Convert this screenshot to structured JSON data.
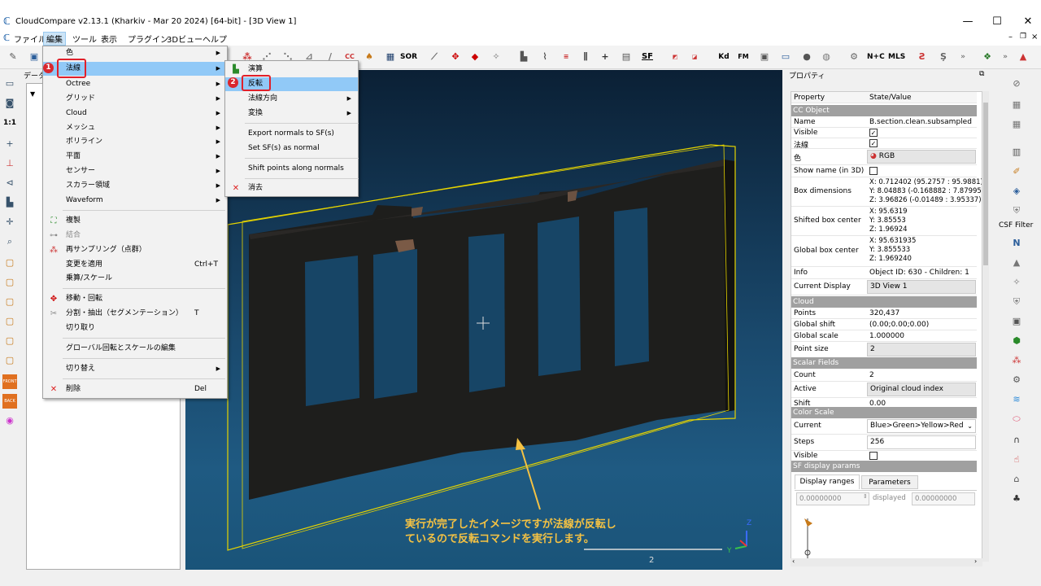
{
  "window": {
    "title": "CloudCompare v2.13.1 (Kharkiv - Mar 20 2024) [64-bit] - [3D View 1]",
    "minimize": "—",
    "maximize": "☐",
    "close": "✕"
  },
  "menubar": [
    "ファイル",
    "編集",
    "ツール",
    "表示",
    "プラグイン",
    "3Dビュー",
    "ヘルプ"
  ],
  "toolbar": {
    "sor": "SOR",
    "sf": "SF",
    "kd": "Kd",
    "fm": "FM",
    "ncc": "N+C",
    "mls": "MLS"
  },
  "left_toolbar": {
    "one_to_one": "1:1",
    "front": "FRONT",
    "back": "BACK"
  },
  "db_panel": {
    "title": "データ"
  },
  "properties": {
    "title": "プロパティ",
    "header_key": "Property",
    "header_value": "State/Value",
    "sections": {
      "cc_object": "CC Object",
      "cloud": "Cloud",
      "scalar_fields": "Scalar Fields",
      "color_scale": "Color Scale",
      "sf_display": "SF display params"
    },
    "rows": {
      "name_k": "Name",
      "name_v": "B.section.clean.subsampled",
      "visible_k": "Visible",
      "normals_k": "法線",
      "color_k": "色",
      "color_v": "RGB",
      "show_name_k": "Show name (in 3D)",
      "box_dim_k": "Box dimensions",
      "box_dim_v": "X: 0.712402 (95.2757 : 95.9881)\nY: 8.04883 (-0.168882 : 7.87995)\nZ: 3.96826 (-0.01489 : 3.95337)",
      "shifted_k": "Shifted box center",
      "shifted_v": "X: 95.6319\nY: 3.85553\nZ: 1.96924",
      "global_k": "Global box center",
      "global_v": "X: 95.631935\nY: 3.855533\nZ: 1.969240",
      "info_k": "Info",
      "info_v": "Object ID: 630 - Children: 1",
      "display_k": "Current Display",
      "display_v": "3D View 1",
      "points_k": "Points",
      "points_v": "320,437",
      "gshift_k": "Global shift",
      "gshift_v": "(0.00;0.00;0.00)",
      "gscale_k": "Global scale",
      "gscale_v": "1.000000",
      "psize_k": "Point size",
      "psize_v": "2",
      "count_k": "Count",
      "count_v": "2",
      "active_k": "Active",
      "active_v": "Original cloud index",
      "shift_k": "Shift",
      "shift_v": "0.00",
      "current_k": "Current",
      "current_v": "Blue>Green>Yellow>Red",
      "steps_k": "Steps",
      "steps_v": "256",
      "cs_visible_k": "Visible"
    },
    "tabs": [
      "Display ranges",
      "Parameters"
    ],
    "range_min": "0.00000000",
    "range_label": "displayed",
    "range_displayed": "0.00000000"
  },
  "right_toolbar": {
    "csf": "CSF Filter"
  },
  "edit_menu": [
    {
      "label": "色",
      "arrow": true
    },
    {
      "label": "法線",
      "arrow": true,
      "highlight": true
    },
    {
      "label": "Octree",
      "arrow": true
    },
    {
      "label": "グリッド",
      "arrow": true
    },
    {
      "label": "Cloud",
      "arrow": true
    },
    {
      "label": "メッシュ",
      "arrow": true
    },
    {
      "label": "ポリライン",
      "arrow": true
    },
    {
      "label": "平面",
      "arrow": true
    },
    {
      "label": "センサー",
      "arrow": true
    },
    {
      "label": "スカラー領域",
      "arrow": true
    },
    {
      "label": "Waveform",
      "arrow": true
    },
    {
      "label": "複製",
      "icon": "clone-icon"
    },
    {
      "label": "結合",
      "icon": "merge-icon",
      "disabled": true
    },
    {
      "label": "再サンプリング（点群）",
      "icon": "subsample-icon"
    },
    {
      "label": "変更を適用",
      "shortcut": "Ctrl+T"
    },
    {
      "label": "乗算/スケール"
    },
    {
      "label": "移動・回転",
      "icon": "translate-rotate-icon"
    },
    {
      "label": "分割・抽出（セグメンテーション）",
      "icon": "segment-icon",
      "shortcut": "T"
    },
    {
      "label": "切り取り"
    },
    {
      "label": "グローバル回転とスケールの編集"
    },
    {
      "label": "切り替え",
      "arrow": true
    },
    {
      "label": "削除",
      "icon": "delete-icon",
      "shortcut": "Del"
    }
  ],
  "normals_submenu": [
    {
      "label": "演算",
      "icon": "compute-normals-icon"
    },
    {
      "label": "反転",
      "highlight": true
    },
    {
      "label": "法線方向",
      "arrow": true
    },
    {
      "label": "変換",
      "arrow": true
    },
    {
      "label": "Export normals to SF(s)"
    },
    {
      "label": "Set SF(s) as normal"
    },
    {
      "label": "Shift points along normals"
    },
    {
      "label": "消去",
      "icon": "clear-icon"
    }
  ],
  "badges": [
    "1",
    "2"
  ],
  "viewport": {
    "scale_label": "2",
    "axis_z": "Z",
    "axis_y": "Y"
  },
  "annotation": {
    "line1": "実行が完了したイメージですが法線が反転し",
    "line2": "ているので反転コマンドを実行します。"
  },
  "colors": {
    "accent_red": "#e0202a",
    "highlight": "#91c9f7",
    "annotation": "#f5c243",
    "bbox": "#e6d400"
  }
}
